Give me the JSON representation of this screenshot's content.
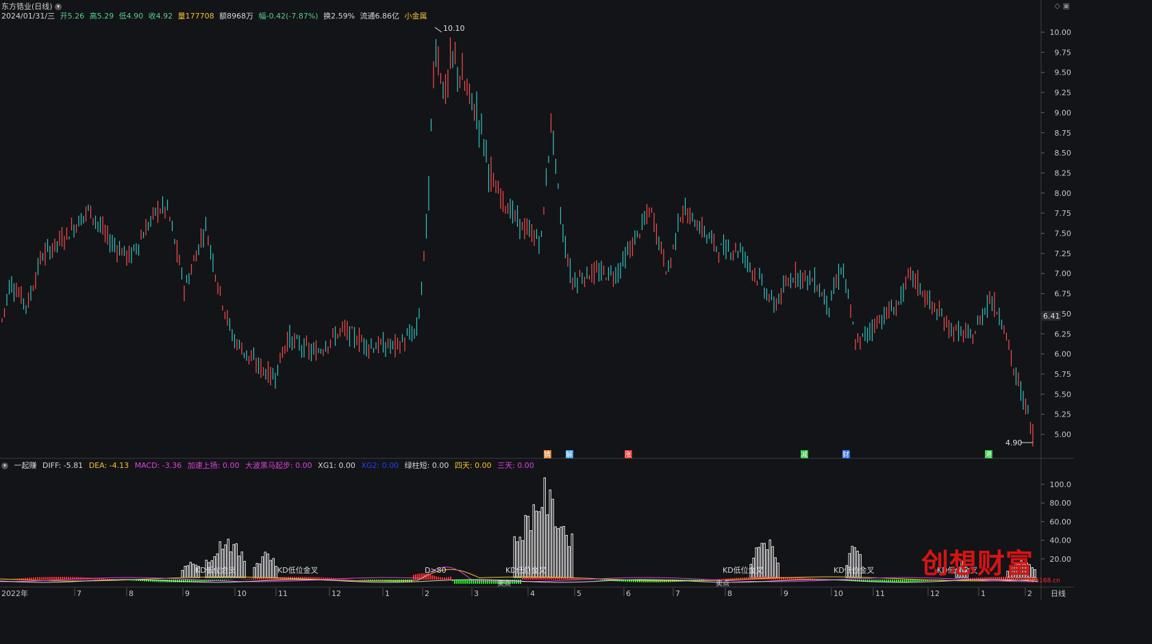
{
  "header": {
    "stock_name": "东方锆业(日线)",
    "date": "2024/01/31/三",
    "open_label": "开5.26",
    "high_label": "高5.29",
    "low_label": "低4.90",
    "close_label": "收4.92",
    "volume_label": "量177708",
    "amount_label": "额8968万",
    "change_label": "幅-0.42(-7.87%)",
    "turnover_label": "换2.59%",
    "float_label": "流通6.86亿",
    "sector_label": "小金属"
  },
  "price_axis": {
    "ticks": [
      "10.00",
      "9.75",
      "9.50",
      "9.25",
      "9.00",
      "8.75",
      "8.50",
      "8.25",
      "8.00",
      "7.75",
      "7.50",
      "7.25",
      "7.00",
      "6.75",
      "6.50",
      "6.25",
      "6.00",
      "5.75",
      "5.50",
      "5.25",
      "5.00"
    ],
    "current_price": "6.41"
  },
  "annotations": {
    "high_marker": "10.10",
    "low_marker": "4.90"
  },
  "event_badges": [
    {
      "label": "猜",
      "color": "#e08030"
    },
    {
      "label": "解",
      "color": "#40a0e0"
    },
    {
      "label": "涨",
      "color": "#e03030"
    },
    {
      "label": "减",
      "color": "#30c040"
    },
    {
      "label": "财",
      "color": "#3070e0"
    },
    {
      "label": "港",
      "color": "#30c040"
    }
  ],
  "indicator": {
    "name": "一起赚",
    "diff": "DIFF: -5.81",
    "dea": "DEA: -4.13",
    "macd": "MACD: -3.36",
    "accel": "加速上扬: 0.00",
    "bigwave": "大波黑马起步: 0.00",
    "xg1": "XG1: 0.00",
    "xg2": "XG2: 0.00",
    "greenbar": "绿柱短: 0.00",
    "fourday": "四天: 0.00",
    "threeday": "三天: 0.00",
    "colors": {
      "diff": "#d8d8d8",
      "dea": "#f2c230",
      "macd": "#e040e0",
      "accel": "#e040e0",
      "bigwave": "#e040e0",
      "xg1": "#d8d8d8",
      "xg2": "#2040ff",
      "greenbar": "#d8d8d8",
      "fourday": "#f2c230",
      "threeday": "#e040e0"
    },
    "axis_ticks": [
      "100.0",
      "80.00",
      "60.00",
      "40.00",
      "20.00"
    ],
    "signal_labels": [
      "KD低位金叉",
      "KD低位金叉",
      "D>80",
      "KD低位金叉",
      "KD低位金叉",
      "KD低位金叉",
      "KD低位金叉"
    ],
    "small_labels": [
      "卖点",
      "卖点"
    ]
  },
  "time_axis": {
    "labels": [
      "2022年",
      "7",
      "8",
      "9",
      "10",
      "11",
      "12",
      "1",
      "2",
      "3",
      "4",
      "5",
      "6",
      "7",
      "8",
      "9",
      "10",
      "11",
      "12",
      "1",
      "2"
    ],
    "period": "日线"
  },
  "watermark": {
    "main": "创想财富",
    "sub": "395168.cn"
  },
  "colors": {
    "up": "#ff4d4d",
    "down": "#2ec8c8",
    "bg": "#131417",
    "grid": "#2a2c30"
  }
}
